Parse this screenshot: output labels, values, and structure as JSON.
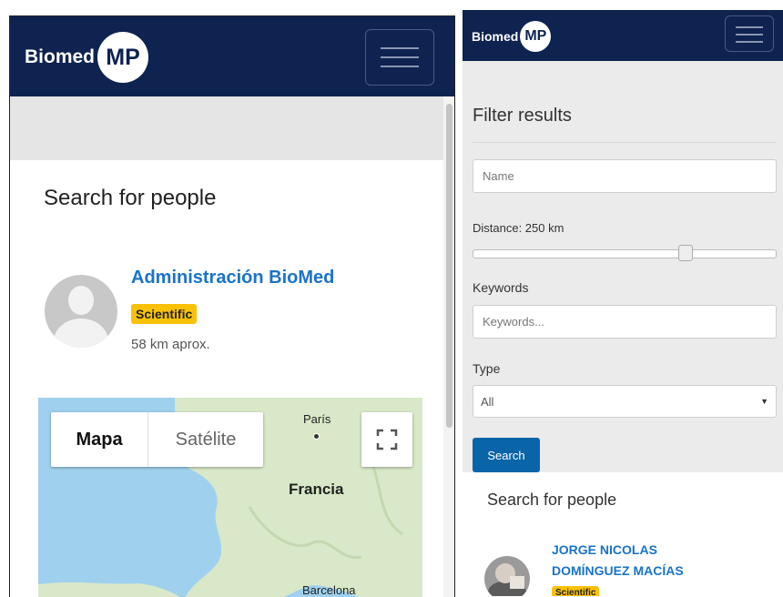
{
  "left": {
    "brand": "Biomed",
    "brand_logo": "MP",
    "menu_icon": "hamburger-icon",
    "section_title": "Search for people",
    "result": {
      "name": "Administración BioMed",
      "badge": "Scientific",
      "distance": "58 km aprox."
    },
    "map": {
      "tab_map": "Mapa",
      "tab_satellite": "Satélite",
      "fullscreen_icon": "fullscreen-icon",
      "labels": {
        "paris": "París",
        "france": "Francia",
        "barcelona": "Barcelona"
      }
    }
  },
  "right": {
    "brand": "Biomed",
    "brand_logo": "MP",
    "menu_icon": "hamburger-icon",
    "filter": {
      "title": "Filter results",
      "name_placeholder": "Name",
      "distance_label": "Distance: 250 km",
      "distance_slider_fraction": 0.71,
      "keywords_label": "Keywords",
      "keywords_placeholder": "Keywords...",
      "type_label": "Type",
      "type_value": "All",
      "search_button": "Search"
    },
    "section_title": "Search for people",
    "result": {
      "name_line1": "JORGE NICOLAS",
      "name_line2": "DOMÍNGUEZ MACÍAS",
      "badge": "Scientific"
    }
  },
  "colors": {
    "navbar": "#0e2350",
    "link": "#1a73c8",
    "badge": "#f9c208",
    "search_button": "#0a64a8",
    "filter_bg": "#ebebeb",
    "map_water": "#9fd1ee",
    "map_land": "#d9e8c8"
  }
}
